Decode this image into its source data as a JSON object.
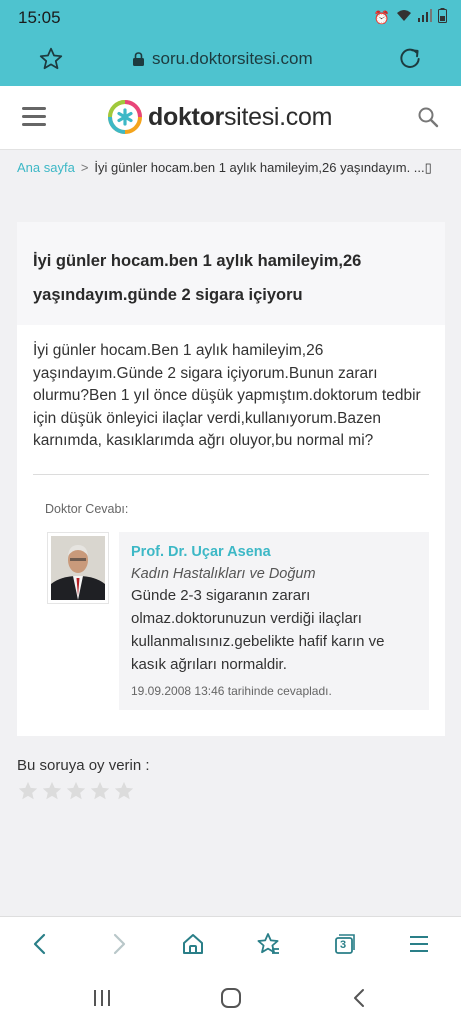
{
  "status": {
    "time": "15:05"
  },
  "browser": {
    "url": "soru.doktorsitesi.com",
    "tab_count": "3"
  },
  "site": {
    "logo_bold": "doktor",
    "logo_normal": "sitesi.com"
  },
  "breadcrumb": {
    "home": "Ana sayfa",
    "separator": ">",
    "current": "İyi günler hocam.ben 1 aylık hamileyim,26 yaşındayım. ...",
    "trailing": "▯"
  },
  "question": {
    "title": "İyi günler hocam.ben 1 aylık hamileyim,26 yaşındayım.günde 2 sigara içiyoru",
    "body": "İyi günler hocam.Ben 1 aylık hamileyim,26 yaşındayım.Günde 2 sigara içiyorum.Bunun zararı olurmu?Ben 1 yıl önce düşük yapmıştım.doktorum tedbir için düşük önleyici ilaçlar verdi,kullanıyorum.Bazen karnımda, kasıklarımda ağrı oluyor,bu normal mi?"
  },
  "answer": {
    "label": "Doktor Cevabı:",
    "doctor_name": "Prof. Dr. Uçar Asena",
    "specialty": "Kadın Hastalıkları ve Doğum",
    "text": "Günde 2-3 sigaranın zararı olmaz.doktorunuzun verdiği ilaçları kullanmalısınız.gebelikte hafif karın ve kasık ağrıları normaldir.",
    "date": "19.09.2008 13:46 tarihinde cevapladı."
  },
  "vote": {
    "label": "Bu soruya oy verin :",
    "rating": 0,
    "max": 5
  },
  "colors": {
    "accent": "#3db8c6",
    "browser_bar": "#4ec3cf"
  }
}
